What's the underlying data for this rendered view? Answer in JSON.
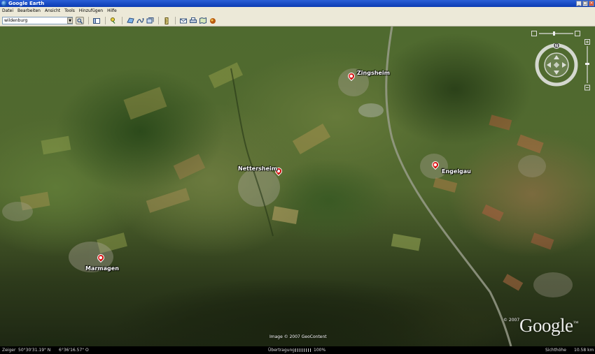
{
  "window": {
    "title": "Google Earth",
    "buttons": {
      "minimize": "_",
      "maximize": "□",
      "close": "×"
    }
  },
  "menu": {
    "items": [
      "Datei",
      "Bearbeiten",
      "Ansicht",
      "Tools",
      "Hinzufügen",
      "Hilfe"
    ]
  },
  "toolbar": {
    "search_value": "wildenburg",
    "dropdown_glyph": "▼"
  },
  "map": {
    "places": [
      {
        "name": "Zingsheim"
      },
      {
        "name": "Nettersheim"
      },
      {
        "name": "Engelgau"
      },
      {
        "name": "Marmagen"
      }
    ],
    "imagery_credit": "Image © 2007 GeoContent",
    "copyright": "© 2007",
    "logo_text": "Google",
    "logo_mark": "™"
  },
  "status": {
    "pointer_label": "Zeiger",
    "latitude": "50°30'31.19\" N",
    "longitude": "6°36'16.57\" O",
    "streaming_label": "Übertragung",
    "streaming_percent": "100%",
    "eye_alt_label": "Sichthöhe",
    "eye_alt_value": "10.58 km"
  },
  "colors": {
    "titlebar": "#0b3bb3",
    "chrome": "#ece9d8",
    "pin": "#d40000",
    "label": "#ffffff"
  }
}
